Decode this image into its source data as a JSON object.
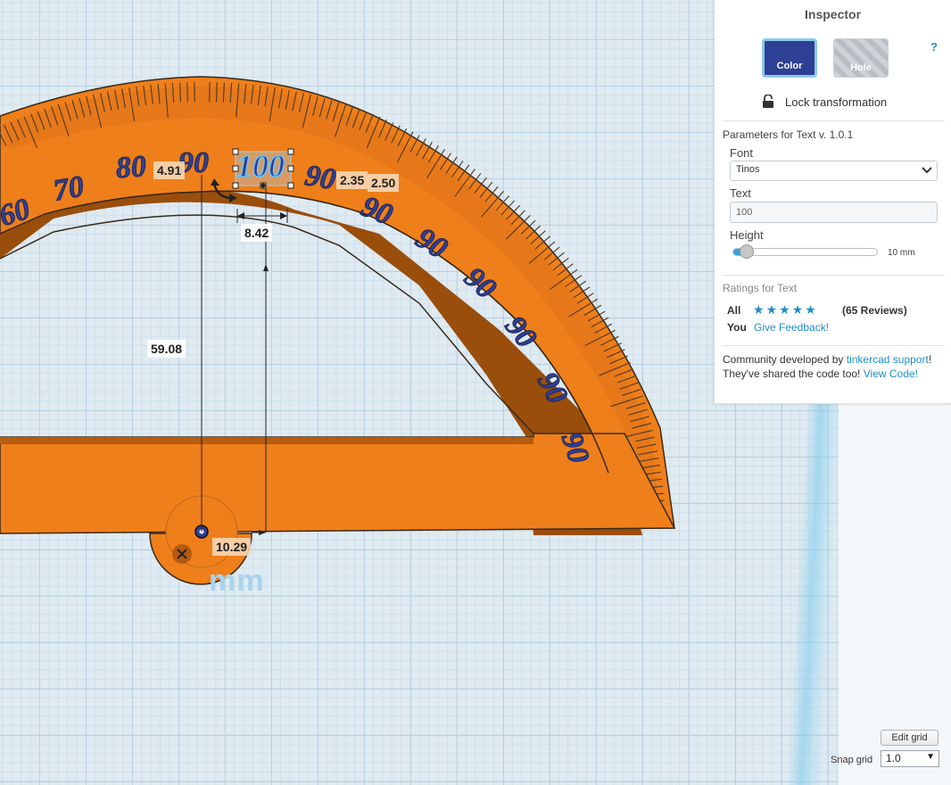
{
  "inspector": {
    "title": "Inspector",
    "help": "?",
    "color_label": "Color",
    "hole_label": "Hole",
    "lock_label": "Lock transformation",
    "params_title": "Parameters for Text v. 1.0.1",
    "font_label": "Font",
    "font_value": "Tinos",
    "text_label": "Text",
    "text_value": "100",
    "height_label": "Height",
    "height_value": "10 mm",
    "height_level": 0.05,
    "ratings_title": "Ratings for Text",
    "all_label": "All",
    "stars": 5,
    "reviews": "(65 Reviews)",
    "you_label": "You",
    "feedback_link": "Give Feedback!",
    "community_pre": "Community developed by ",
    "community_link": "tinkercad support",
    "community_mid": "!",
    "shared_text": "They've shared the code too! ",
    "view_code": "View Code!"
  },
  "colors": {
    "accent": "#2a8fc8",
    "object_orange": "#ef7f1a",
    "text_blue": "#2e3f96"
  },
  "scene": {
    "scale_numbers": [
      "60",
      "70",
      "80",
      "90"
    ],
    "selected_text": "100",
    "repeated_label": "90",
    "dimensions": {
      "left_offset": "4.91",
      "width": "8.42",
      "right_a": "2.35",
      "right_b": "2.50",
      "vertical": "59.08",
      "bottom": "10.29"
    },
    "unit": "mm"
  },
  "grid": {
    "edit_label": "Edit grid",
    "snap_label": "Snap grid",
    "snap_value": "1.0"
  }
}
